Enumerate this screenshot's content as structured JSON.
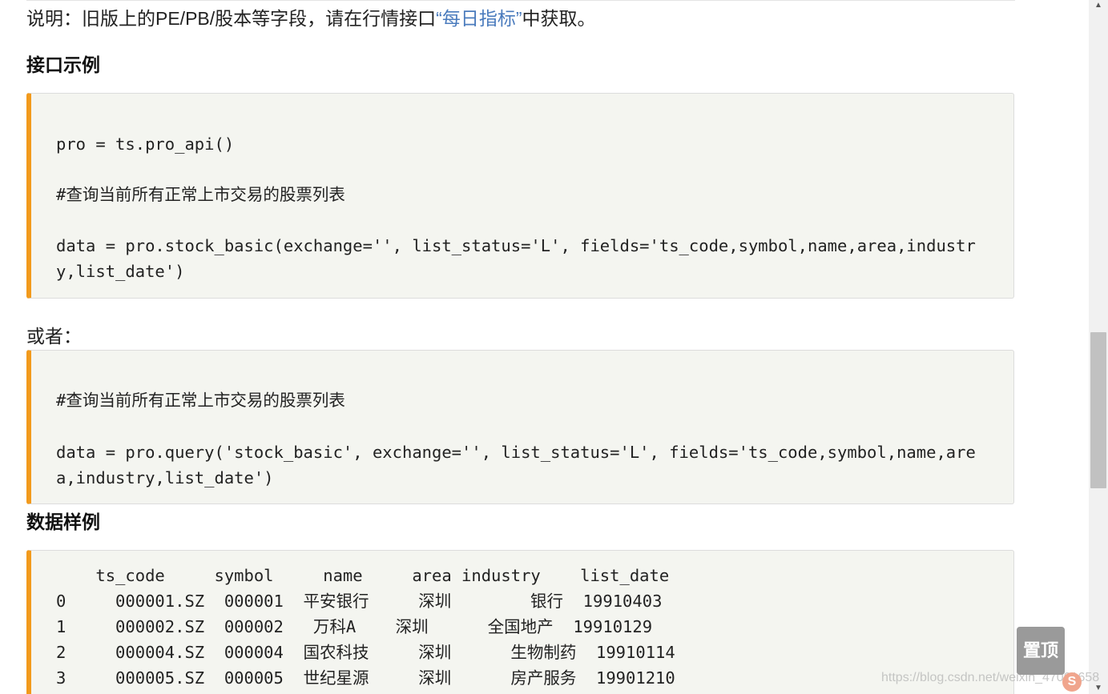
{
  "note": {
    "prefix": "说明：旧版上的PE/PB/股本等字段，请在行情接口",
    "link": "“每日指标”",
    "suffix": "中获取。"
  },
  "sections": {
    "example_heading": "接口示例",
    "or_text": "或者：",
    "sample_heading": "数据样例"
  },
  "code_example": {
    "line1": "pro = ts.pro_api()",
    "line2": "#查询当前所有正常上市交易的股票列表",
    "line3": "data = pro.stock_basic(exchange='', list_status='L', fields='ts_code,symbol,name,area,industr",
    "line4": "y,list_date')"
  },
  "code_alt": {
    "line1": "#查询当前所有正常上市交易的股票列表",
    "line2": "data = pro.query('stock_basic', exchange='', list_status='L', fields='ts_code,symbol,name,are",
    "line3": "a,industry,list_date')"
  },
  "sample_table": {
    "header": "    ts_code     symbol     name     area industry    list_date",
    "rows": [
      "0     000001.SZ  000001  平安银行     深圳        银行  19910403",
      "1     000002.SZ  000002   万科A    深圳      全国地产  19910129",
      "2     000004.SZ  000004  国农科技     深圳      生物制药  19910114",
      "3     000005.SZ  000005  世纪星源     深圳      房产服务  19901210"
    ]
  },
  "back_to_top": "置顶",
  "watermark": "https://blog.csdn.net/weixin_47001658",
  "csdn_badge": "S"
}
